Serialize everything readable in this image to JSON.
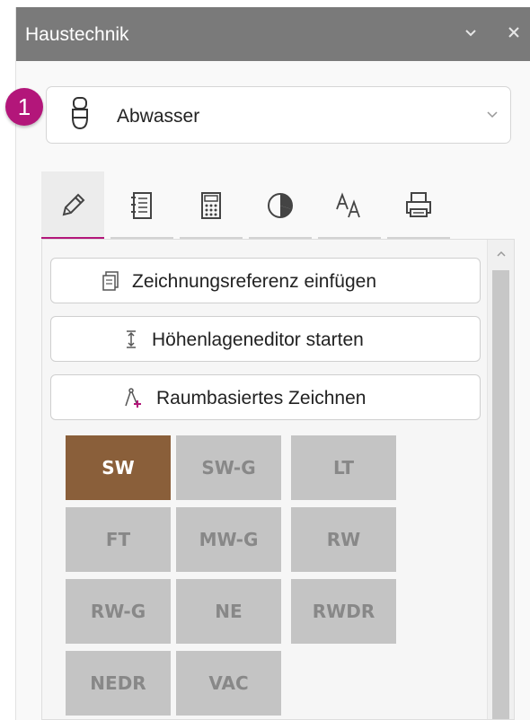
{
  "panel": {
    "title": "Haustechnik"
  },
  "step_badge": "1",
  "category": {
    "value": "Abwasser"
  },
  "tabs": [
    {
      "name": "tab-draw",
      "icon": "pencil-icon"
    },
    {
      "name": "tab-list",
      "icon": "list-icon"
    },
    {
      "name": "tab-calculate",
      "icon": "calculator-icon"
    },
    {
      "name": "tab-chart",
      "icon": "pie-chart-icon"
    },
    {
      "name": "tab-text",
      "icon": "text-style-icon"
    },
    {
      "name": "tab-print",
      "icon": "printer-icon"
    }
  ],
  "actions": {
    "insert_reference": "Zeichnungsreferenz einfügen",
    "height_editor": "Höhenlageneditor starten",
    "room_drawing": "Raumbasiertes Zeichnen"
  },
  "tiles": [
    "SW",
    "SW-G",
    "LT",
    "FT",
    "MW-G",
    "RW",
    "RW-G",
    "NE",
    "RWDR",
    "NEDR",
    "VAC"
  ],
  "selected_tile": "SW",
  "colors": {
    "accent": "#b3167a",
    "selected_tile": "#8a5f3a",
    "tile": "#c4c4c4",
    "titlebar": "#7a7a7a"
  }
}
